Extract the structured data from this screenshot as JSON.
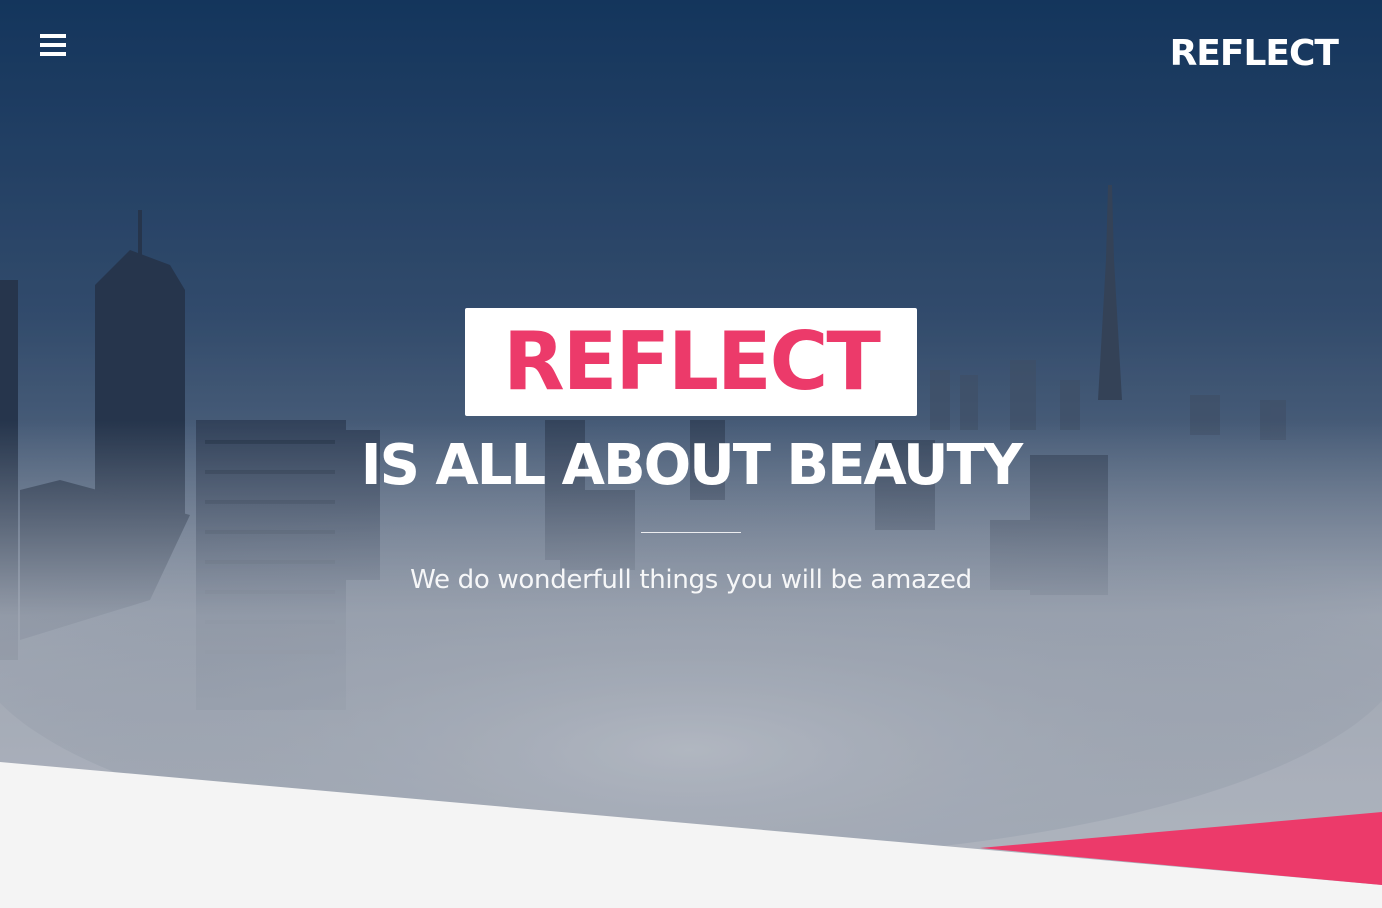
{
  "header": {
    "menu_icon": "hamburger-menu-icon",
    "logo_text": "REFLECT"
  },
  "hero": {
    "brand": "REFLECT",
    "tagline": "IS ALL ABOUT BEAUTY",
    "subtitle": "We do wonderfull things you will be amazed"
  },
  "colors": {
    "accent": "#ec3a6a",
    "sky_top": "#163b66",
    "fog": "#c4c9d3",
    "footer_bg": "#f4f4f4"
  }
}
